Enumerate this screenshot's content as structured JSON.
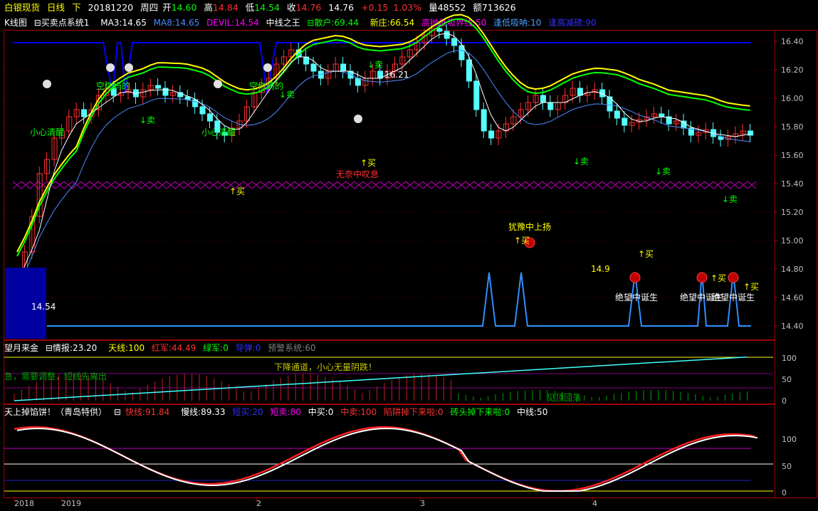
{
  "header": {
    "product": "白银现货",
    "period": "日线",
    "direction": "下",
    "date": "20181220",
    "weekday": "周四",
    "open_label": "开",
    "open": "14.60",
    "high_label": "高",
    "high": "14.84",
    "low_label": "低",
    "low": "14.54",
    "close_label": "收",
    "close": "14.76",
    "last": "14.76",
    "change": "+0.15",
    "change_pct": "1.03%",
    "volume_label": "量",
    "volume": "48552",
    "amount_label": "额",
    "amount": "713626"
  },
  "indicators": {
    "chart_type": "K线图",
    "system": "买卖点系统1",
    "ma3": "MA3:14.65",
    "ma8": "MA8:14.65",
    "devil": "DEVIL:14.54",
    "mid_king": "中线之王",
    "retail": "散户:69.44",
    "new_dealer": "新庄:66.54",
    "high_sell": "高抛低吸界线:50",
    "low_buy": "逢低吸呐:10",
    "high_reduce": "逢高减磅:90"
  },
  "main_chart": {
    "y_ticks": [
      "16.40",
      "16.20",
      "16.00",
      "15.80",
      "15.60",
      "15.40",
      "15.20",
      "15.00",
      "14.80",
      "14.60",
      "14.40"
    ],
    "labels": {
      "high_price": "16.21",
      "low_price": "14.54",
      "mark_149": "14.9",
      "caution1": "小心清醒",
      "caution2": "小心清醒",
      "empty1": "空你妈的",
      "empty2": "空你妈的",
      "sigh": "无奈中叹息",
      "hesitate": "犹豫中上扬",
      "despair1": "绝望中诞生",
      "despair2": "绝望中诞生",
      "despair3": "绝望中诞生",
      "sell": "↓卖",
      "buy": "↑买"
    }
  },
  "panel2": {
    "title": "望月来金",
    "intel": "情报:23.20",
    "sky": "天线:100",
    "red": "红军:44.49",
    "green": "绿军:0",
    "guide": "导弹:0",
    "warn": "预警系统:60",
    "notice": "下降通道，小心无量阴跌！",
    "left_note": "急，需要调整，短线先离出",
    "bottom_note": "见顶回落",
    "y_ticks": [
      "100",
      "50",
      "0"
    ]
  },
  "panel3": {
    "title": "天上掉馅饼！（青岛特供）",
    "fast": "快线:91.84",
    "slow": "慢线:89.33",
    "short_buy": "短买:20",
    "short_sell": "短卖:80",
    "mid_buy": "中买:0",
    "mid_sell": "中卖:100",
    "trap": "陷阱掉下来啦:0",
    "brick": "砖头掉下来啦:0",
    "midline": "中线:50",
    "y_ticks": [
      "100",
      "50",
      "0"
    ]
  },
  "x_axis": [
    "2018",
    "2019",
    "2",
    "3",
    "4"
  ],
  "colors": {
    "up": "#ff3030",
    "down": "#54ffff",
    "yellow": "#ffff00",
    "green": "#00ff00",
    "magenta": "#ff00ff",
    "blue": "#0000ff",
    "frame": "#a00000"
  }
}
